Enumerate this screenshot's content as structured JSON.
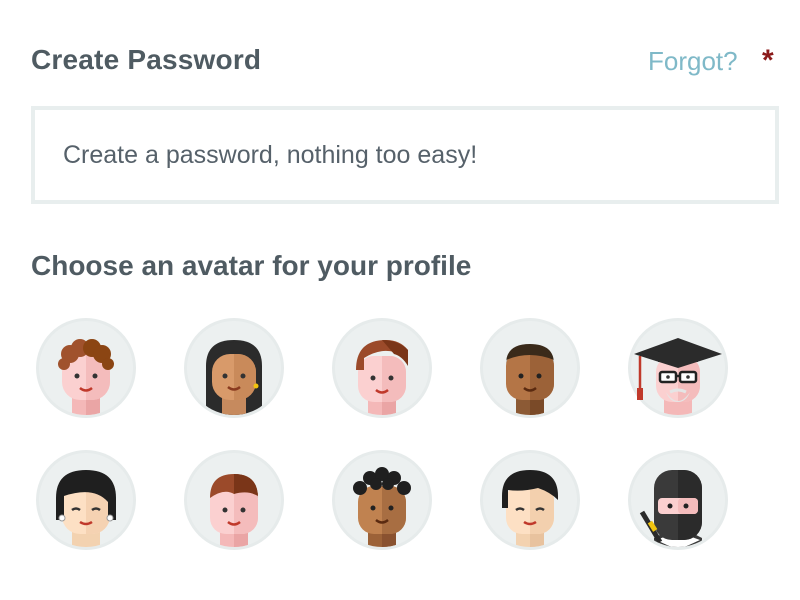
{
  "password_section": {
    "title": "Create Password",
    "forgot_link": "Forgot?",
    "required_marker": "*",
    "input_placeholder": "Create a password, nothing too easy!"
  },
  "avatar_section": {
    "title": "Choose an avatar for your profile",
    "avatars": [
      {
        "icon": "curly-hair-boy-avatar-icon"
      },
      {
        "icon": "long-hair-woman-avatar-icon"
      },
      {
        "icon": "quiff-man-avatar-icon"
      },
      {
        "icon": "dark-skin-man-avatar-icon"
      },
      {
        "icon": "graduate-professor-avatar-icon"
      },
      {
        "icon": "bob-hair-girl-avatar-icon"
      },
      {
        "icon": "short-hair-boy-avatar-icon"
      },
      {
        "icon": "curly-hair-man-avatar-icon"
      },
      {
        "icon": "asian-man-avatar-icon"
      },
      {
        "icon": "ninja-avatar-icon"
      }
    ]
  },
  "colors": {
    "heading": "#4f5b62",
    "link": "#7fb9c8",
    "required": "#8b1a1a",
    "border": "#e8eeee",
    "avatar_ring": "#e6ebeb"
  }
}
